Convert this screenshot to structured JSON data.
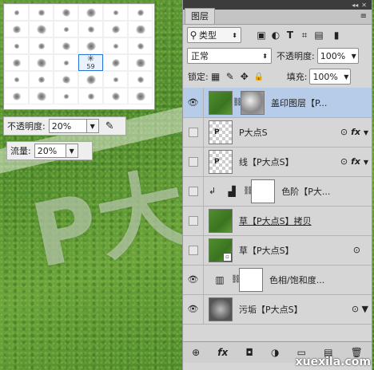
{
  "canvas": {
    "big_text": "P大"
  },
  "brush_picker": {
    "selected_size": "59",
    "cells": 36
  },
  "options": {
    "opacity_label": "不透明度:",
    "opacity_value": "20%",
    "flow_label": "流量:",
    "flow_value": "20%"
  },
  "panel": {
    "tab_label": "图层",
    "filter_label": "类型",
    "blend_mode": "正常",
    "opacity_label": "不透明度:",
    "opacity_value": "100%",
    "lock_label": "锁定:",
    "fill_label": "填充:",
    "fill_value": "100%",
    "icons": {
      "filter_image": "▣",
      "filter_adjust": "◐",
      "filter_type": "T",
      "filter_shape": "⌗",
      "filter_smart": "▤",
      "lock_pixels": "▦",
      "lock_brush": "✎",
      "lock_move": "✥",
      "lock_all": "🔒"
    }
  },
  "layers": [
    {
      "name": "盖印图层【P...",
      "thumb": "grass-text",
      "mask": true,
      "visible": true,
      "active": true
    },
    {
      "name": "P大点S",
      "thumb": "checker",
      "mask": false,
      "visible": false,
      "fx": true
    },
    {
      "name": "线【P大点S】",
      "thumb": "checker",
      "mask": false,
      "visible": false,
      "fx": true
    },
    {
      "name": "色阶【P大...",
      "thumb": "levels",
      "mask": true,
      "visible": false,
      "clipped": true
    },
    {
      "name": "草【P大点S】拷贝",
      "thumb": "grass",
      "mask": false,
      "visible": false
    },
    {
      "name": "草【P大点S】",
      "thumb": "grass",
      "mask": false,
      "visible": false,
      "smart": true
    },
    {
      "name": "色相/饱和度...",
      "thumb": "huesat",
      "mask": true,
      "visible": true
    },
    {
      "name": "污垢【P大点S】",
      "thumb": "dark",
      "mask": false,
      "visible": true,
      "fx_arrow": true
    }
  ],
  "footer": {
    "icons": [
      "link-icon",
      "fx-icon",
      "mask-icon",
      "adjustment-icon",
      "folder-icon",
      "new-layer-icon",
      "trash-icon"
    ],
    "glyphs": [
      "⊕",
      "fx",
      "◘",
      "◑",
      "▭",
      "▤",
      "🗑"
    ]
  },
  "watermark": "xuexila.com"
}
